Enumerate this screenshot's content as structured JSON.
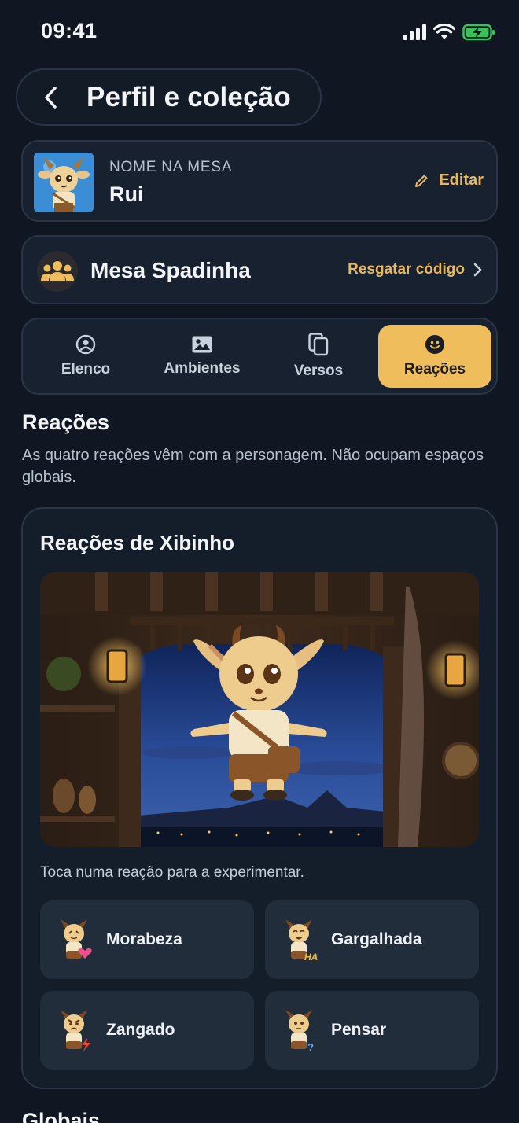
{
  "status": {
    "time": "09:41"
  },
  "header": {
    "title": "Perfil e coleção"
  },
  "profile": {
    "label": "NOME NA MESA",
    "name": "Rui",
    "edit_label": "Editar"
  },
  "mesa": {
    "name": "Mesa Spadinha",
    "redeem_label": "Resgatar código"
  },
  "tabs": [
    {
      "label": "Elenco",
      "icon": "person-circle-icon",
      "active": false
    },
    {
      "label": "Ambientes",
      "icon": "image-icon",
      "active": false
    },
    {
      "label": "Versos",
      "icon": "copy-icon",
      "active": false
    },
    {
      "label": "Reações",
      "icon": "smiley-icon",
      "active": true
    }
  ],
  "section": {
    "title": "Reações",
    "description": "As quatro reações vêm com a personagem. Não ocupam espaços globais."
  },
  "reactions": {
    "title": "Reações de Xibinho",
    "hint": "Toca numa reação para a experimentar.",
    "items": [
      {
        "label": "Morabeza",
        "badge": "heart-icon",
        "badge_color": "#f0508a"
      },
      {
        "label": "Gargalhada",
        "badge": "HA",
        "badge_color": "#f0b93a"
      },
      {
        "label": "Zangado",
        "badge": "lightning-icon",
        "badge_color": "#e8483c"
      },
      {
        "label": "Pensar",
        "badge": "?",
        "badge_color": "#5aa8e8"
      }
    ]
  },
  "next_section": {
    "title": "Globais"
  },
  "colors": {
    "accent": "#efbd5c",
    "background": "#101722",
    "card": "#172130"
  }
}
